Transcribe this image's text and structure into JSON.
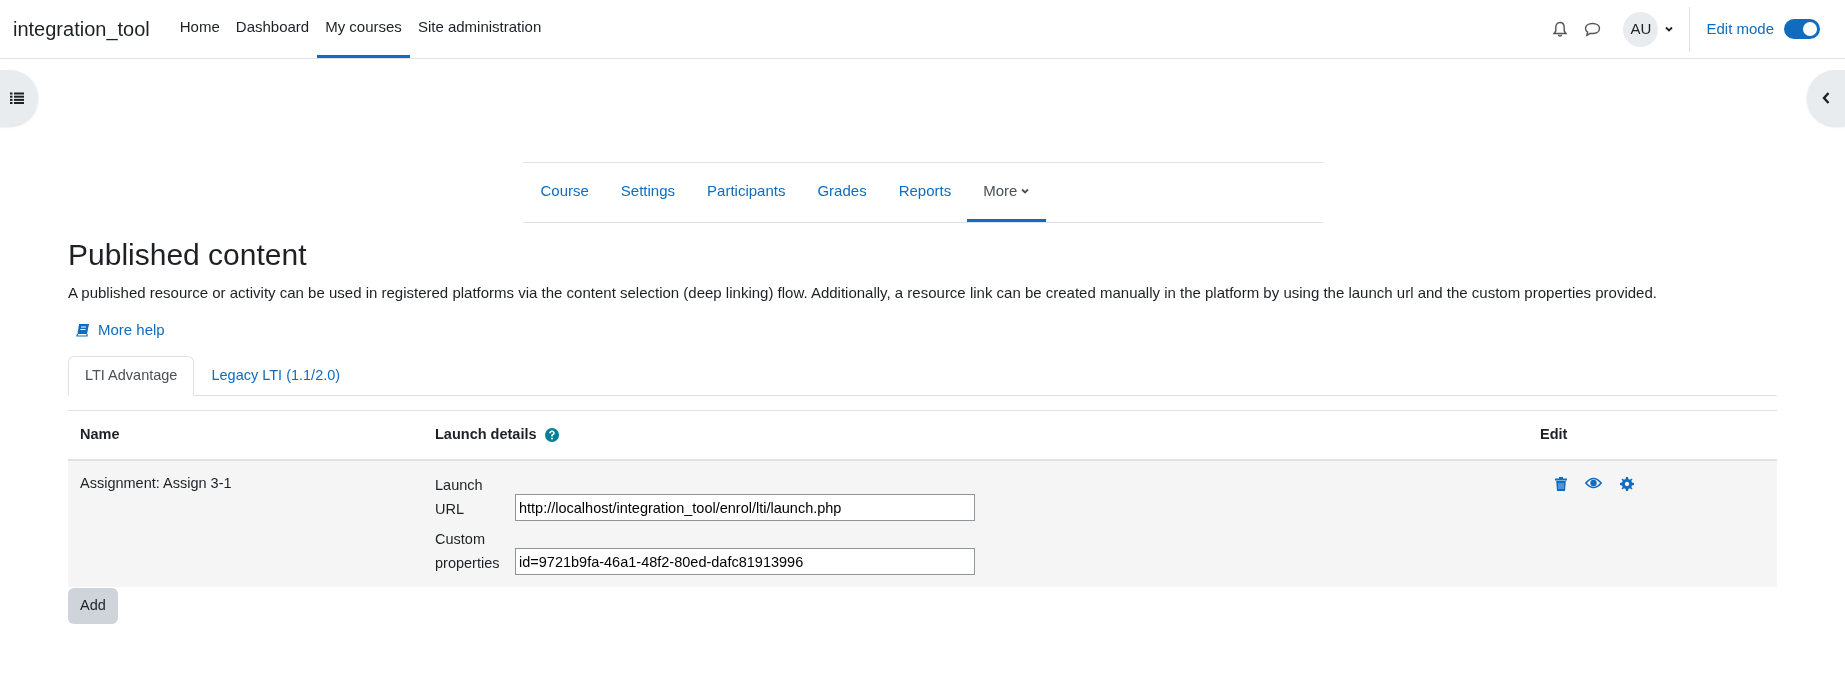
{
  "navbar": {
    "brand": "integration_tool",
    "items": [
      {
        "label": "Home",
        "selected": false
      },
      {
        "label": "Dashboard",
        "selected": false
      },
      {
        "label": "My courses",
        "selected": true
      },
      {
        "label": "Site administration",
        "selected": false
      }
    ],
    "avatar": "AU",
    "edit_mode": {
      "label": "Edit mode",
      "on": true
    }
  },
  "course_nav": [
    {
      "label": "Course",
      "selected": false
    },
    {
      "label": "Settings",
      "selected": false
    },
    {
      "label": "Participants",
      "selected": false
    },
    {
      "label": "Grades",
      "selected": false
    },
    {
      "label": "Reports",
      "selected": false
    },
    {
      "label": "More",
      "selected": true
    }
  ],
  "heading": "Published content",
  "description": "A published resource or activity can be used in registered platforms via the content selection (deep linking) flow. Additionally, a resource link can be created manually in the platform by using the launch url and the custom properties provided.",
  "more_help": "More help",
  "tabs": [
    {
      "label": "LTI Advantage",
      "selected": true
    },
    {
      "label": "Legacy LTI (1.1/2.0)",
      "selected": false
    }
  ],
  "table": {
    "columns": [
      "Name",
      "Launch details",
      "Edit"
    ],
    "rows": [
      {
        "name": "Assignment: Assign 3-1",
        "fields": [
          {
            "label": "Launch URL",
            "value": "http://localhost/integration_tool/enrol/lti/launch.php"
          },
          {
            "label": "Custom properties",
            "value": "id=9721b9fa-46a1-48f2-80ed-dafc81913996"
          }
        ]
      }
    ]
  },
  "add_button": "Add"
}
